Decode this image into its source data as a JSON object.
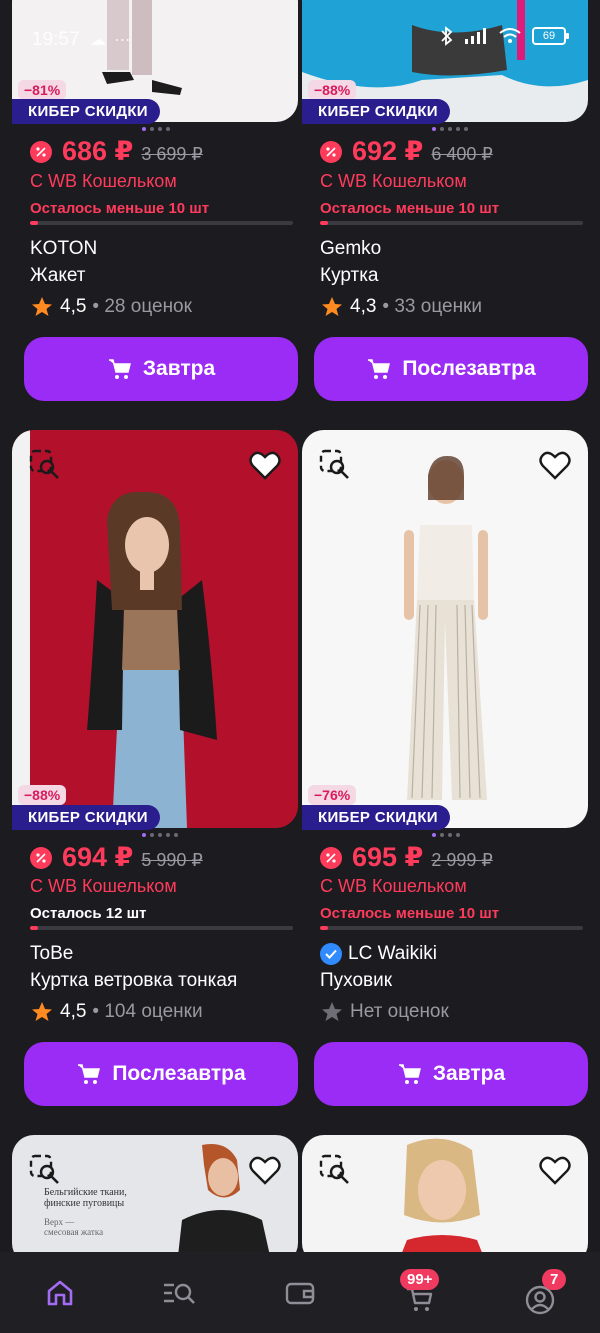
{
  "status_bar": {
    "time": "19:57",
    "battery": "69"
  },
  "cards": [
    {
      "discount": "−81%",
      "promo": "КИБЕР СКИДКИ",
      "price": "686 ₽",
      "old_price": "3 699 ₽",
      "wallet": "С WB Кошельком",
      "stock": "Осталось меньше 10 шт",
      "stock_level": 0.03,
      "brand": "KOTON",
      "product": "Жакет",
      "rating": "4,5",
      "reviews": "• 28 оценок",
      "button": "Завтра"
    },
    {
      "discount": "−88%",
      "promo": "КИБЕР СКИДКИ",
      "price": "692 ₽",
      "old_price": "6 400 ₽",
      "wallet": "С WB Кошельком",
      "stock": "Осталось меньше 10 шт",
      "stock_level": 0.03,
      "brand": "Gemko",
      "product": "Куртка",
      "rating": "4,3",
      "reviews": "• 33 оценки",
      "button": "Послезавтра"
    },
    {
      "discount": "−88%",
      "promo": "КИБЕР СКИДКИ",
      "price": "694 ₽",
      "old_price": "5 990 ₽",
      "wallet": "С WB Кошельком",
      "stock": "Осталось 12 шт",
      "stock_level": 0.03,
      "brand": "ToBe",
      "product": "Куртка ветровка тонкая",
      "rating": "4,5",
      "reviews": "• 104 оценки",
      "button": "Послезавтра"
    },
    {
      "discount": "−76%",
      "promo": "КИБЕР СКИДКИ",
      "price": "695 ₽",
      "old_price": "2 999 ₽",
      "wallet": "С WB Кошельком",
      "stock": "Осталось меньше 10 шт",
      "stock_level": 0.03,
      "brand": "LC Waikiki",
      "product": "Пуховик",
      "rating": "",
      "reviews": "Нет оценок",
      "button": "Завтра"
    }
  ],
  "partial_card_text": {
    "line1": "Бельгийские ткани,",
    "line2": "финские пуговицы",
    "line3": "Верх —",
    "line4": "смесовая жатка"
  },
  "nav": {
    "cart_badge": "99+",
    "profile_badge": "7"
  },
  "colors": {
    "accent": "#9b2cf5",
    "price": "#ff3b5c",
    "promo": "#2a1d8e"
  }
}
